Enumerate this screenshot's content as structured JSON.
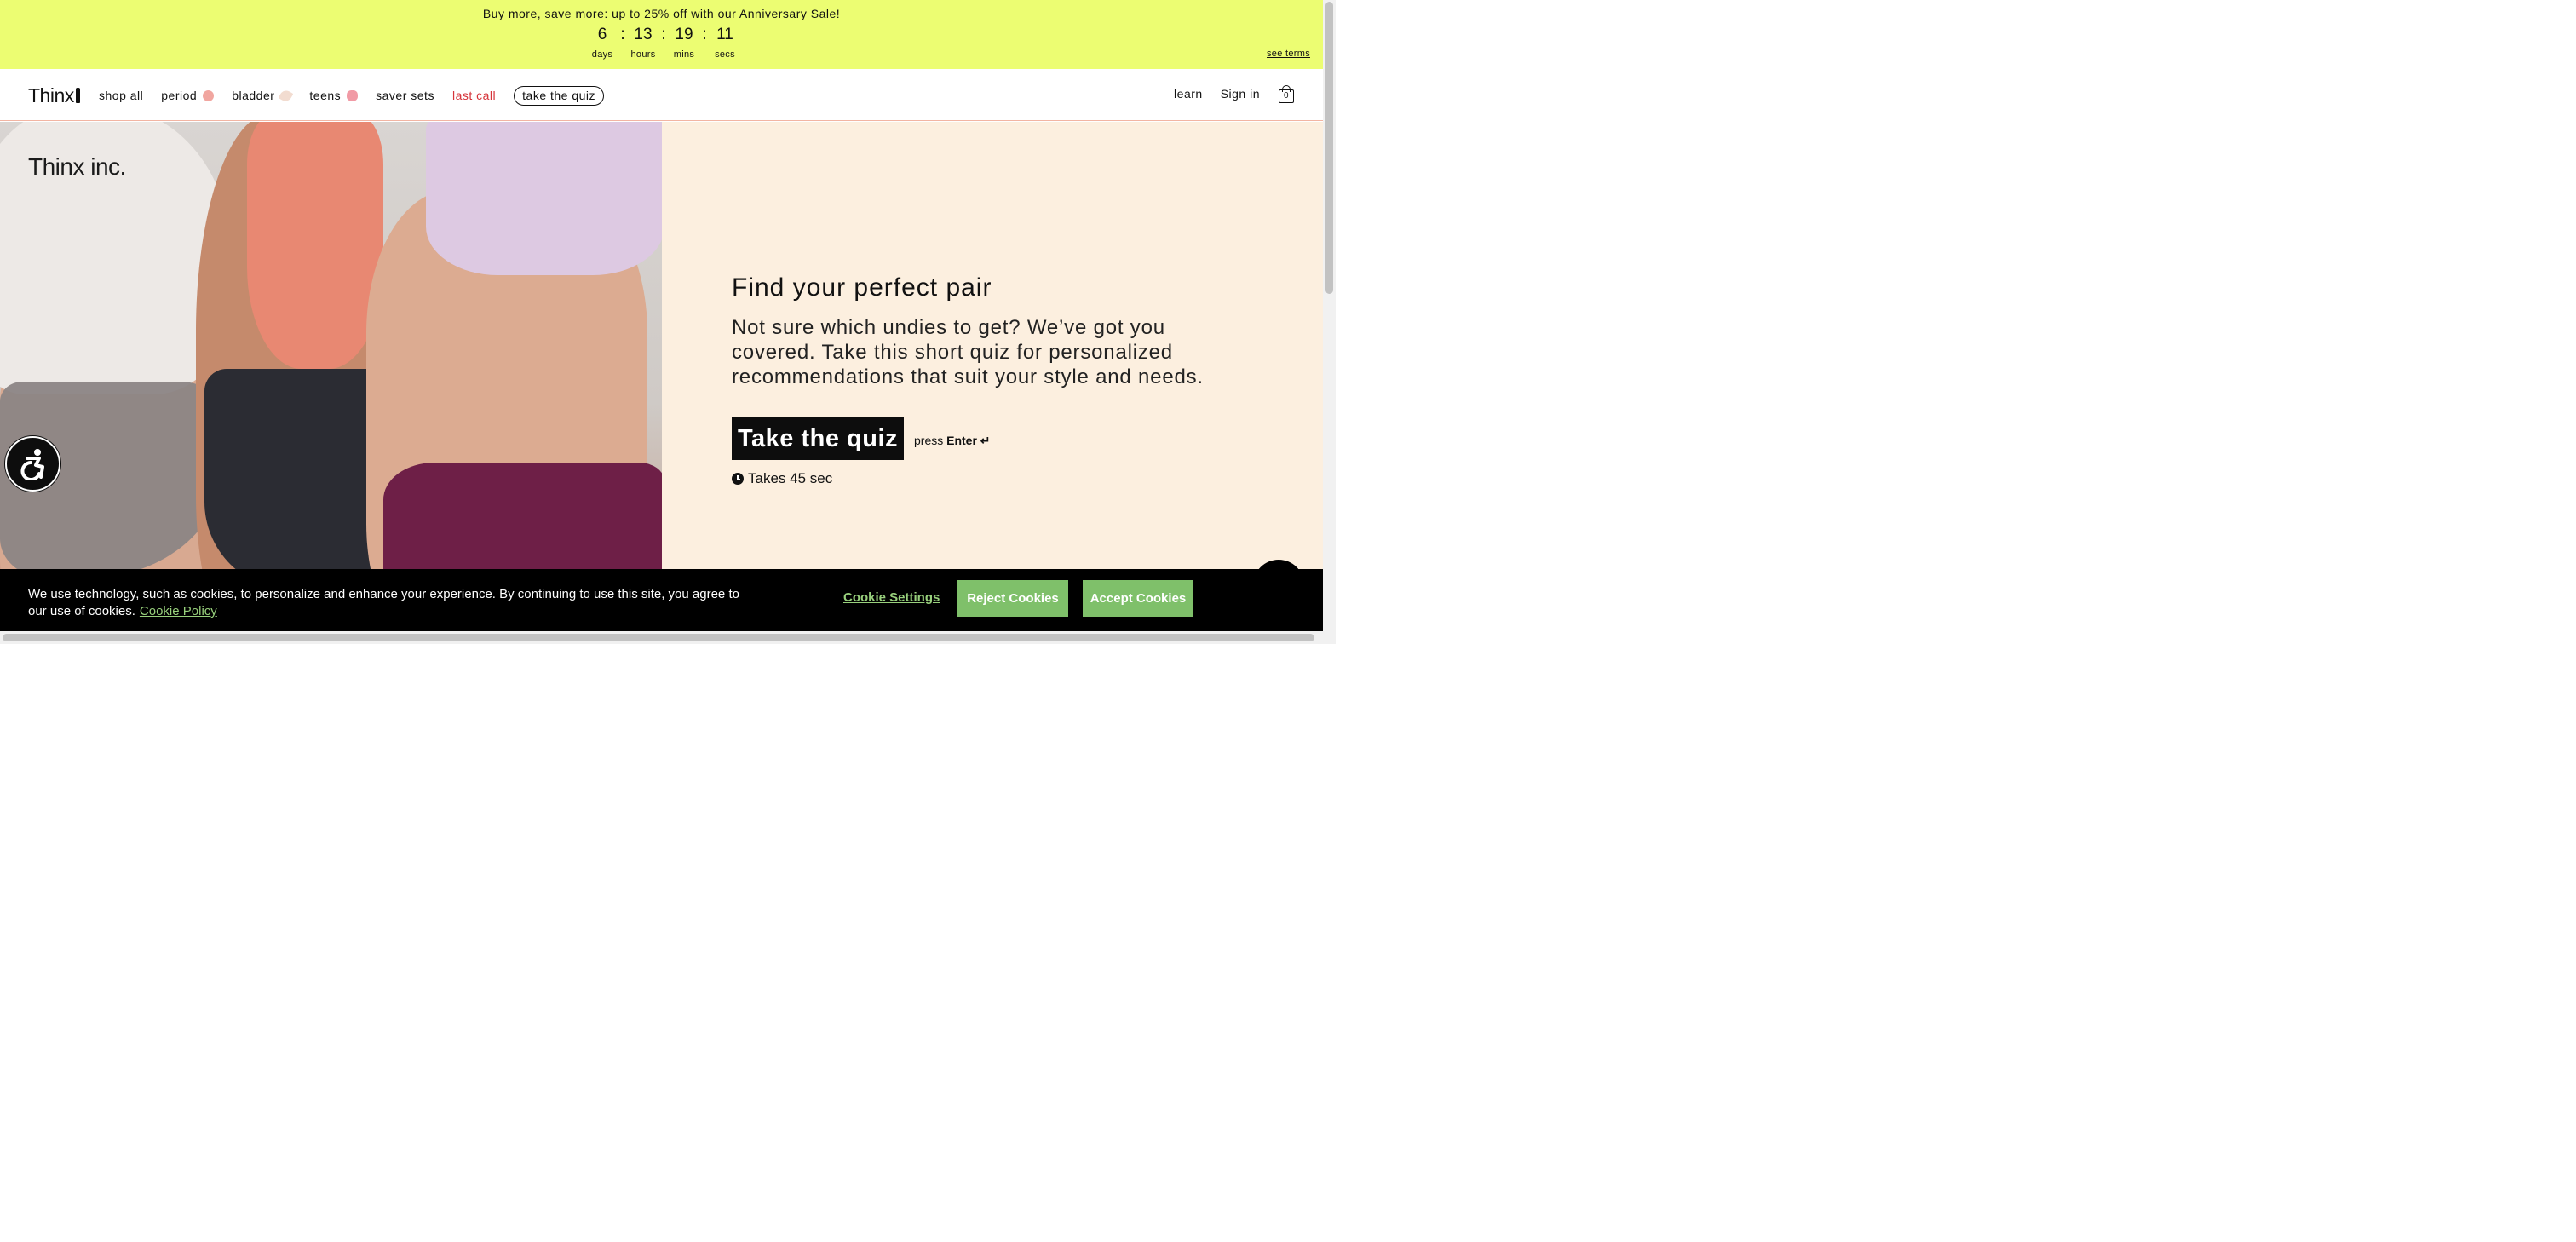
{
  "promo": {
    "text": "Buy more, save more: up to 25% off with our  Anniversary Sale!",
    "countdown": {
      "days": "6",
      "hours": "13",
      "mins": "19",
      "secs": "11",
      "days_label": "days",
      "hours_label": "hours",
      "mins_label": "mins",
      "secs_label": "secs",
      "separator": ":"
    },
    "see_terms": "see terms",
    "background": "#ecfd72"
  },
  "header": {
    "logo": "Thinx",
    "nav": [
      {
        "label": "shop all"
      },
      {
        "label": "period",
        "icon": "period-dot-icon"
      },
      {
        "label": "bladder",
        "icon": "bladder-leaf-icon"
      },
      {
        "label": "teens",
        "icon": "teens-flower-icon"
      },
      {
        "label": "saver sets"
      },
      {
        "label": "last call",
        "color": "#d6343a"
      },
      {
        "label": "take the quiz"
      }
    ],
    "learn": "learn",
    "sign_in": "Sign in",
    "cart_count": "0"
  },
  "hero": {
    "brand_watermark": "Thinx inc.",
    "title": "Find your perfect pair",
    "description": "Not sure which undies to get? We’ve got you covered. Take this short quiz for personalized recommendations that suit your style and needs.",
    "cta": "Take the quiz",
    "press": "press",
    "enter": "Enter ↵",
    "takes": "Takes 45 sec",
    "background": "#fcefdf"
  },
  "cookie": {
    "text": "We use technology, such as cookies, to personalize and enhance your experience. By continuing to use this site, you agree to our use of cookies.",
    "policy_link": "Cookie Policy",
    "settings": "Cookie Settings",
    "reject": "Reject Cookies",
    "accept": "Accept Cookies",
    "accent": "#7fc06a"
  }
}
